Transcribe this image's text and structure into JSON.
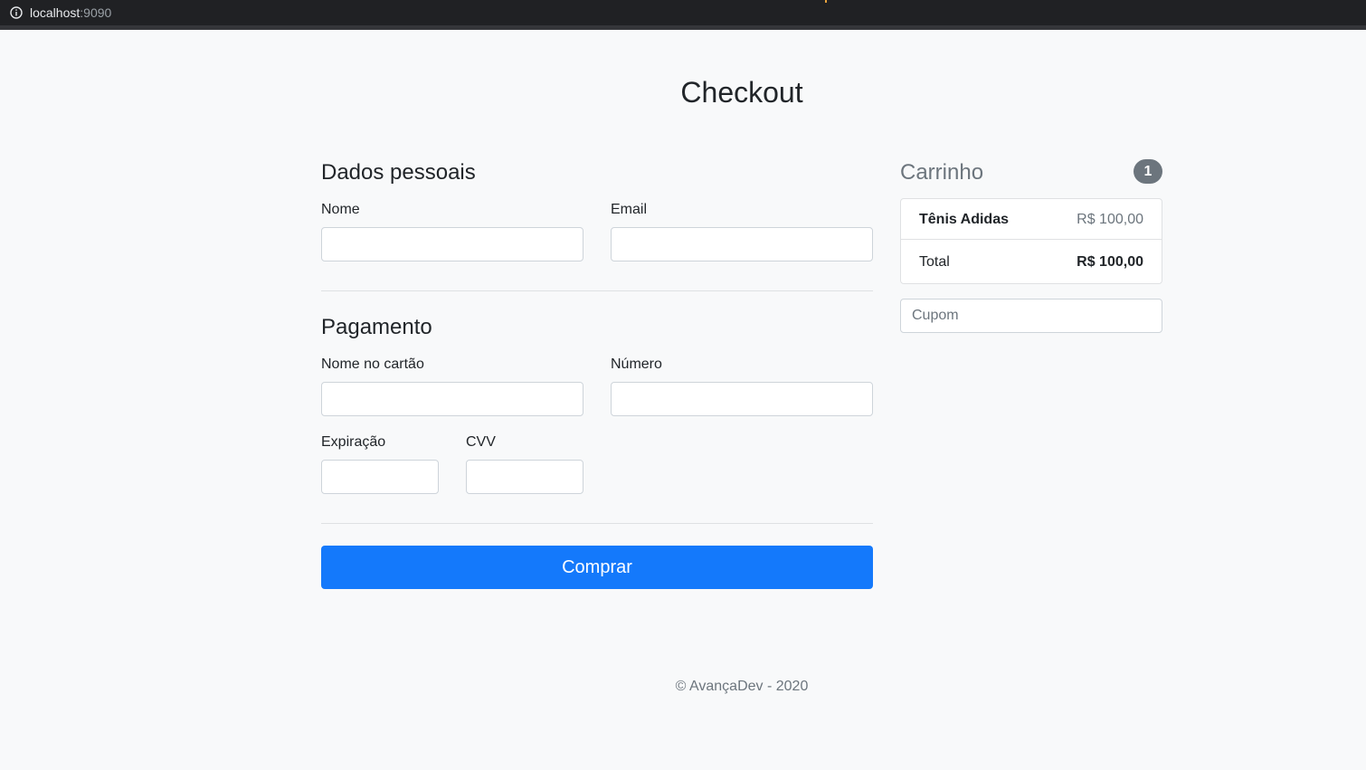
{
  "browser": {
    "host": "localhost",
    "port": ":9090"
  },
  "page": {
    "title": "Checkout"
  },
  "personal": {
    "heading": "Dados pessoais",
    "name_label": "Nome",
    "email_label": "Email",
    "name_value": "",
    "email_value": ""
  },
  "payment": {
    "heading": "Pagamento",
    "card_name_label": "Nome no cartão",
    "card_number_label": "Número",
    "expiration_label": "Expiração",
    "cvv_label": "CVV",
    "card_name_value": "",
    "card_number_value": "",
    "expiration_value": "",
    "cvv_value": ""
  },
  "submit": {
    "label": "Comprar",
    "color": "#1479fb"
  },
  "cart": {
    "heading": "Carrinho",
    "count": "1",
    "items": [
      {
        "name": "Tênis Adidas",
        "price": "R$ 100,00"
      }
    ],
    "total_label": "Total",
    "total_value": "R$ 100,00",
    "coupon_placeholder": "Cupom"
  },
  "footer": {
    "text": "© AvançaDev - 2020"
  },
  "icons": {
    "address_bar": "info-icon"
  }
}
